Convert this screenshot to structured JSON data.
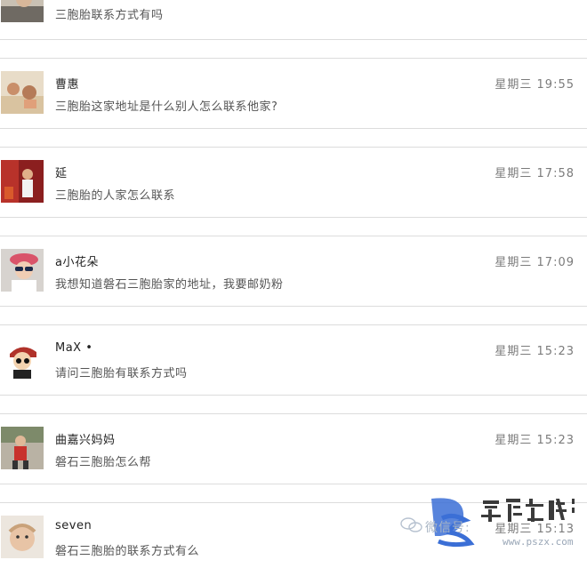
{
  "messages": [
    {
      "name": "",
      "time": "",
      "text": "三胞胎联系方式有吗"
    },
    {
      "name": "曹惠",
      "time": "星期三 19:55",
      "text": "三胞胎这家地址是什么别人怎么联系他家?"
    },
    {
      "name": "延",
      "time": "星期三 17:58",
      "text": "三胞胎的人家怎么联系"
    },
    {
      "name": "a小花朵",
      "time": "星期三 17:09",
      "text": "我想知道磐石三胞胎家的地址，我要邮奶粉"
    },
    {
      "name": "MaX •",
      "time": "星期三 15:23",
      "text": "请问三胞胎有联系方式吗"
    },
    {
      "name": "曲嘉兴妈妈",
      "time": "星期三 15:23",
      "text": "磐石三胞胎怎么帮"
    },
    {
      "name": "seven",
      "time": "星期三 15:13",
      "text": "磐石三胞胎的联系方式有么"
    }
  ],
  "watermark": {
    "text": "微信号: ",
    "calligraphy": "磐石在线",
    "url": "www.pszx.com"
  },
  "colors": {
    "separator": "#dcdcdc",
    "time": "#7b7b7b",
    "watermark_blue": "#3b6fd6"
  }
}
